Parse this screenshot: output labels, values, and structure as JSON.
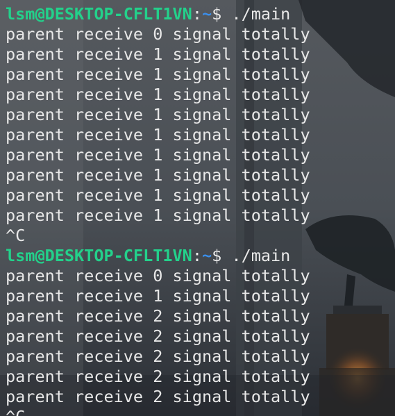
{
  "window": {
    "app": "terminal"
  },
  "colors": {
    "prompt_user": "#23d18b",
    "prompt_path": "#3b8eea",
    "text": "#e8e8e8"
  },
  "terminal": {
    "prompt": {
      "user_host": "lsm@DESKTOP-CFLT1VN",
      "colon": ":",
      "path": "~",
      "symbol": "$ "
    },
    "lines": [
      {
        "type": "prompt",
        "command": "./main"
      },
      {
        "type": "output",
        "text": "parent receive 0 signal totally"
      },
      {
        "type": "output",
        "text": "parent receive 1 signal totally"
      },
      {
        "type": "output",
        "text": "parent receive 1 signal totally"
      },
      {
        "type": "output",
        "text": "parent receive 1 signal totally"
      },
      {
        "type": "output",
        "text": "parent receive 1 signal totally"
      },
      {
        "type": "output",
        "text": "parent receive 1 signal totally"
      },
      {
        "type": "output",
        "text": "parent receive 1 signal totally"
      },
      {
        "type": "output",
        "text": "parent receive 1 signal totally"
      },
      {
        "type": "output",
        "text": "parent receive 1 signal totally"
      },
      {
        "type": "output",
        "text": "parent receive 1 signal totally"
      },
      {
        "type": "output",
        "text": "^C"
      },
      {
        "type": "prompt",
        "command": "./main"
      },
      {
        "type": "output",
        "text": "parent receive 0 signal totally"
      },
      {
        "type": "output",
        "text": "parent receive 1 signal totally"
      },
      {
        "type": "output",
        "text": "parent receive 2 signal totally"
      },
      {
        "type": "output",
        "text": "parent receive 2 signal totally"
      },
      {
        "type": "output",
        "text": "parent receive 2 signal totally"
      },
      {
        "type": "output",
        "text": "parent receive 2 signal totally"
      },
      {
        "type": "output",
        "text": "parent receive 2 signal totally"
      },
      {
        "type": "output",
        "text": "^C"
      }
    ]
  }
}
